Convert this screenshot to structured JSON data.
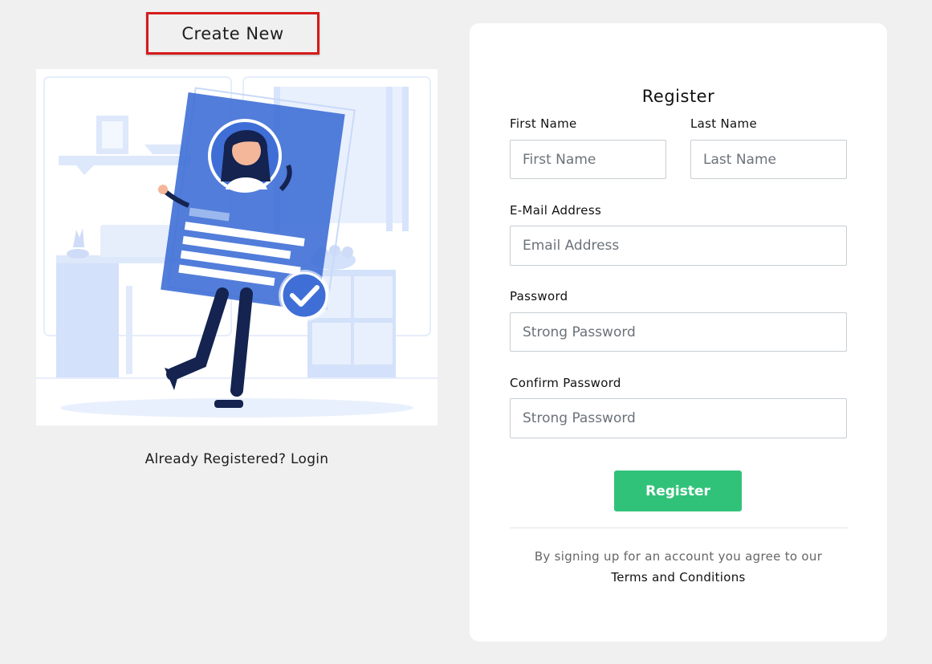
{
  "left_panel": {
    "create_new_label": "Create New",
    "already_registered_text": "Already Registered?",
    "login_link": "Login"
  },
  "register_card": {
    "title": "Register",
    "fields": {
      "first_name": {
        "label": "First Name",
        "placeholder": "First Name",
        "value": ""
      },
      "last_name": {
        "label": "Last Name",
        "placeholder": "Last Name",
        "value": ""
      },
      "email": {
        "label": "E-Mail Address",
        "placeholder": "Email Address",
        "value": ""
      },
      "password": {
        "label": "Password",
        "placeholder": "Strong Password",
        "value": ""
      },
      "confirm_password": {
        "label": "Confirm Password",
        "placeholder": "Strong Password",
        "value": ""
      }
    },
    "submit_label": "Register",
    "terms_prefix": "By signing up for an account you agree to our",
    "terms_link": "Terms and Conditions"
  },
  "colors": {
    "page_background": "#f0f0f0",
    "highlight_border": "#d61a1a",
    "button_green": "#31c27a",
    "illustration_blue": "#3f6fd6",
    "illustration_navy": "#14234f"
  },
  "icons": {
    "illustration": "registration-illustration",
    "checkmark": "check-badge-icon"
  }
}
